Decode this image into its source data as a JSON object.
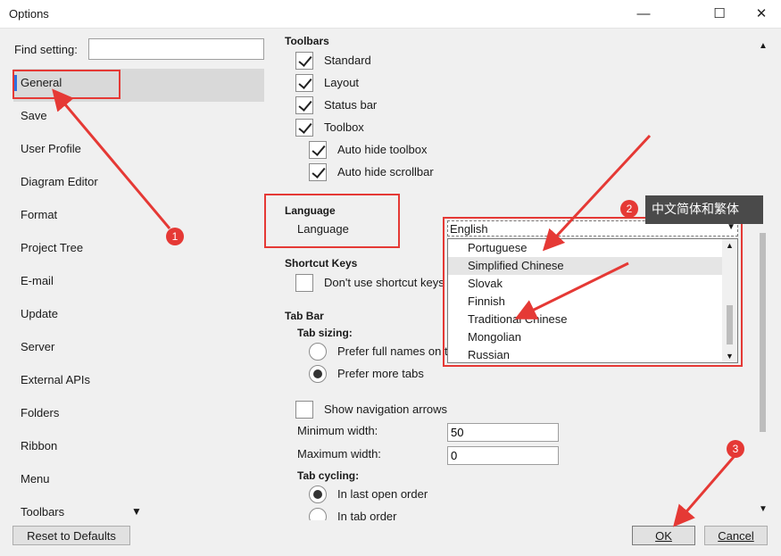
{
  "window": {
    "title": "Options",
    "minimize": "—",
    "maximize": "☐",
    "close": "✕"
  },
  "left": {
    "find_label": "Find setting:",
    "find_value": "",
    "nav_items": [
      "General",
      "Save",
      "User Profile",
      "Diagram Editor",
      "Format",
      "Project Tree",
      "E-mail",
      "Update",
      "Server",
      "External APIs",
      "Folders",
      "Ribbon",
      "Menu",
      "Toolbars"
    ],
    "more_arrow": "▼",
    "reset_label": "Reset to Defaults"
  },
  "toolbars": {
    "heading": "Toolbars",
    "items": [
      {
        "label": "Standard",
        "checked": true
      },
      {
        "label": "Layout",
        "checked": true
      },
      {
        "label": "Status bar",
        "checked": true
      },
      {
        "label": "Toolbox",
        "checked": true
      },
      {
        "label": "Auto hide toolbox",
        "checked": true
      },
      {
        "label": "Auto hide scrollbar",
        "checked": true
      }
    ]
  },
  "language": {
    "heading": "Language",
    "label": "Language",
    "selected": "English",
    "options": [
      "Portuguese",
      "Simplified Chinese",
      "Slovak",
      "Finnish",
      "Traditional Chinese",
      "Mongolian",
      "Russian"
    ],
    "highlighted": "Simplified Chinese"
  },
  "shortcut": {
    "heading": "Shortcut Keys",
    "option": "Don't use shortcut keys"
  },
  "tabbar": {
    "heading": "Tab Bar",
    "sizing_heading": "Tab sizing:",
    "sizing_options": [
      "Prefer full names on tabs",
      "Prefer more tabs"
    ],
    "sizing_selected": 1,
    "nav_arrows": "Show navigation arrows",
    "min_label": "Minimum width:",
    "min_value": "50",
    "max_label": "Maximum width:",
    "max_value": "0",
    "cycling_heading": "Tab cycling:",
    "cycling_options": [
      "In last open order",
      "In tab order"
    ],
    "cycling_selected": 0
  },
  "buttons": {
    "ok": "OK",
    "cancel": "Cancel"
  },
  "annotations": {
    "step1": "1",
    "step2": "2",
    "step3": "3",
    "tooltip": "中文简体和繁体"
  },
  "colors": {
    "annotation": "#e53935",
    "accent": "#2f6fe0",
    "tooltip_bg": "#4a4a4a"
  }
}
